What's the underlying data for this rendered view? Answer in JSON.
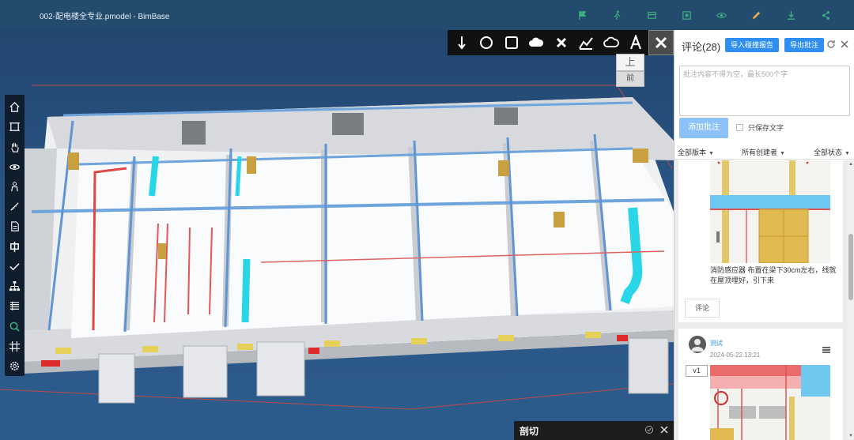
{
  "app": {
    "title": "002-配电楼全专业.pmodel - BimBase"
  },
  "top_tools": [
    "flag-icon",
    "walk-icon",
    "layers-icon",
    "fit-view-icon",
    "eye-icon",
    "pencil-icon",
    "download-icon",
    "share-icon"
  ],
  "colors": {
    "topbar": "#234b6e",
    "accent": "#2f8ff0",
    "active_tool": "#f0a94a",
    "top_icon": "#3fae82"
  },
  "markup_tools": [
    "arrow-down-icon",
    "circle-icon",
    "rectangle-icon",
    "cloud-icon",
    "cross-icon",
    "polyline-icon",
    "cloud-outline-icon",
    "text-icon",
    "close-markup-icon"
  ],
  "view_cube": {
    "top": "上",
    "front": "前"
  },
  "left_tools": [
    "home-icon",
    "frame-icon",
    "pan-hand-icon",
    "orbit-icon",
    "person-icon",
    "measure-icon",
    "document-icon",
    "section-icon",
    "check-icon",
    "tree-icon",
    "list-icon",
    "search-icon",
    "grid-icon",
    "settings-icon"
  ],
  "section_panel": {
    "title": "剖切"
  },
  "panel": {
    "title": "评论(28)",
    "import_button": "导入碰撞报告",
    "export_button": "导出批注",
    "input_placeholder": "批注内容不得为空，最长500个字",
    "add_button": "添加批注",
    "only_text_label": "只保存文字",
    "filters": {
      "version": "全部版本",
      "creator": "所有创建者",
      "status": "全部状态"
    },
    "card1": {
      "text": "消防感应器 布置在梁下30cm左右，线就在屋顶埋好，引下来",
      "comment_button": "评论"
    },
    "card2": {
      "author": "测试",
      "time": "2024-05-22 13:21",
      "version": "v1"
    }
  }
}
